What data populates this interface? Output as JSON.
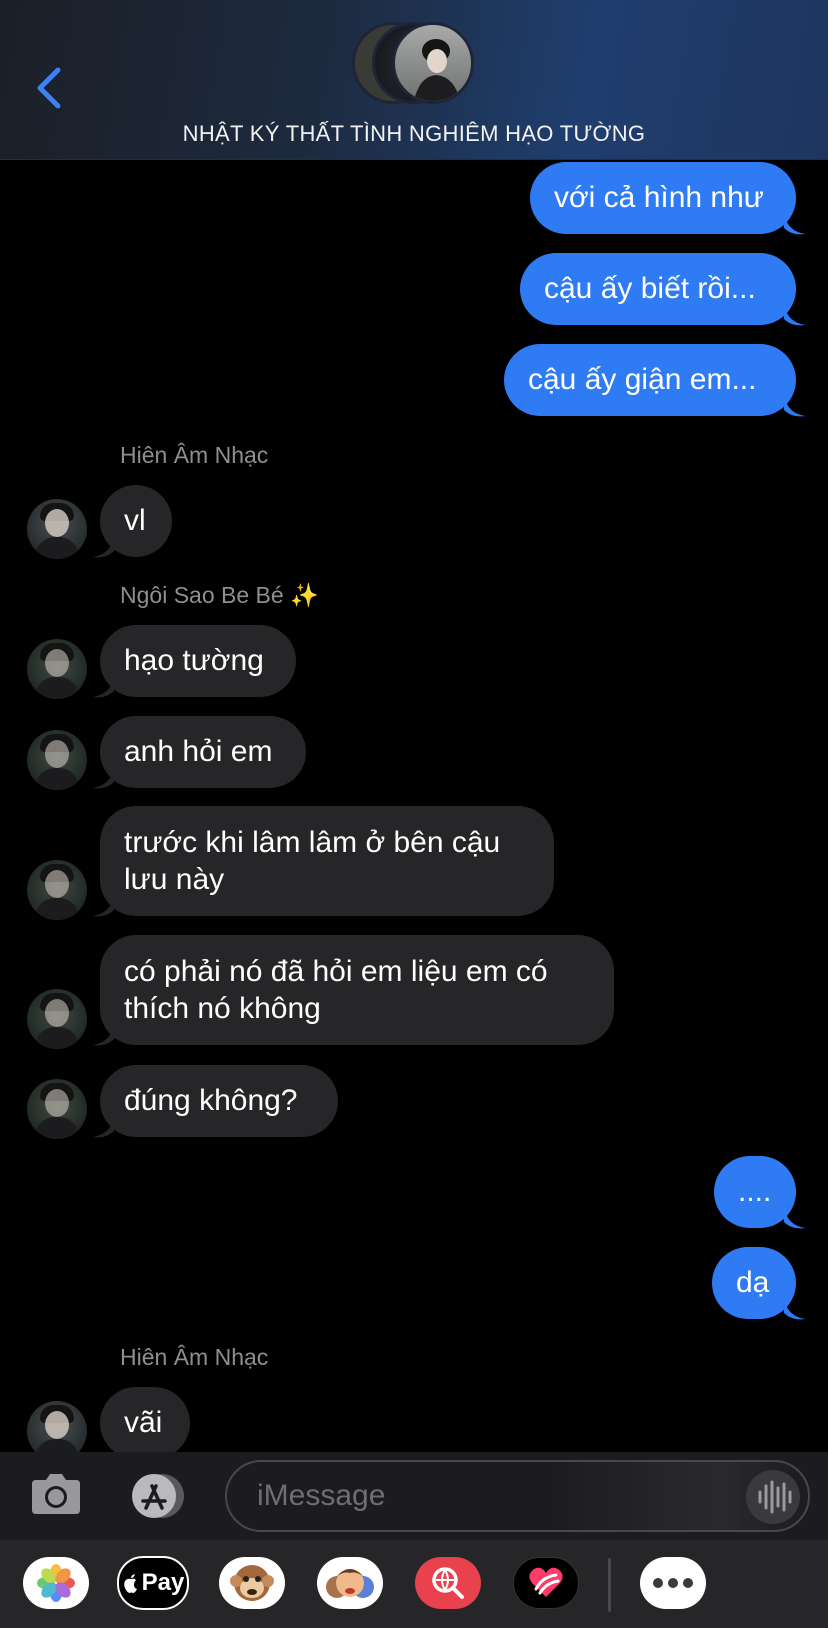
{
  "header": {
    "title": "NHẬT KÝ THẤT TÌNH NGHIÊM HẠO TƯỜNG",
    "back_icon": "chevron-left-icon"
  },
  "messages": [
    {
      "type": "out",
      "text": "với cả hình như"
    },
    {
      "type": "out",
      "text": "cậu ấy biết rồi..."
    },
    {
      "type": "out",
      "text": "cậu ấy giận em..."
    },
    {
      "type": "sender",
      "text": "Hiên Âm Nhạc"
    },
    {
      "type": "in",
      "text": "vl"
    },
    {
      "type": "sender",
      "text": "Ngôi Sao Be Bé ✨"
    },
    {
      "type": "in",
      "text": "hạo tường"
    },
    {
      "type": "in",
      "text": "anh hỏi em"
    },
    {
      "type": "in",
      "text": "trước khi lâm lâm ở bên cậu lưu này"
    },
    {
      "type": "in",
      "text": "có phải nó đã hỏi em liệu em có thích nó không"
    },
    {
      "type": "in",
      "text": "đúng không?"
    },
    {
      "type": "out",
      "text": "...."
    },
    {
      "type": "out",
      "text": "dạ"
    },
    {
      "type": "sender",
      "text": "Hiên Âm Nhạc"
    },
    {
      "type": "in",
      "text": "vãi"
    }
  ],
  "composer": {
    "placeholder": "iMessage",
    "camera_icon": "camera-icon",
    "appstore_icon": "app-store-icon",
    "audio_icon": "waveform-icon"
  },
  "tray": {
    "apps": [
      "photos-icon",
      "apple-pay-icon",
      "animoji-icon",
      "memoji-icon",
      "web-search-icon",
      "digital-touch-icon",
      "more-icon"
    ],
    "apple_pay_label": "Pay"
  },
  "colors": {
    "outgoing": "#2f7bf4",
    "incoming": "#262628",
    "accent": "#3b82f6"
  }
}
